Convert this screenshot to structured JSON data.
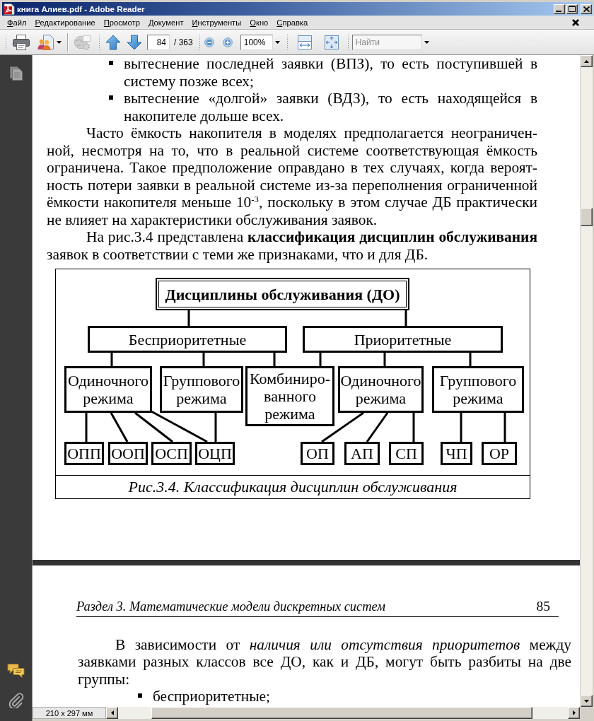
{
  "window": {
    "title": "книга Алиев.pdf - Adobe Reader"
  },
  "menu": [
    "Файл",
    "Редактирование",
    "Просмотр",
    "Документ",
    "Инструменты",
    "Окно",
    "Справка"
  ],
  "toolbar": {
    "items": [
      {
        "kind": "print",
        "disabled": false
      },
      {
        "kind": "share",
        "disabled": false
      },
      {
        "kind": "globe",
        "disabled": true
      },
      {
        "kind": "previous_page",
        "disabled": false
      },
      {
        "kind": "next_page",
        "disabled": false
      },
      {
        "kind": "page_field",
        "value": "84",
        "total": "/ 363"
      },
      {
        "kind": "zoom_out",
        "disabled": false
      },
      {
        "kind": "zoom_in",
        "disabled": false
      },
      {
        "kind": "zoom_field",
        "value": "100%"
      },
      {
        "kind": "fit_width",
        "disabled": false
      },
      {
        "kind": "fit_page",
        "disabled": false
      },
      {
        "kind": "search_field",
        "placeholder": "Найти"
      }
    ]
  },
  "page_1": {
    "blocks": [
      {
        "kind": "bullet",
        "text": "вытеснение последней заявки (ВПЗ), то есть поступившей в систему позже всех;"
      },
      {
        "kind": "bullet",
        "text": "вытеснение «долгой» заявки (ВДЗ), то есть находящейся в накопителе дольше всех."
      },
      {
        "kind": "paragraph",
        "text": "Часто ёмкость накопителя в моделях предполагается неограничен-ной, несмотря на то, что в реальной системе соответствующая ёмкость ограничена. Такое предположение оправдано в тех случаях, когда вероят-ность потери заявки в реальной системе из-за переполнения ограниченной ёмкости накопителя меньше 10$^{-3}$, поскольку в этом случае ДБ практически не влияет на характеристики обслуживания заявок."
      },
      {
        "kind": "paragraph",
        "text": "На рис.3.4 представлена **классификация дисциплин обслуживания** заявок в соответствии с теми же признаками, что и для ДБ."
      }
    ],
    "figure": {
      "root": {
        "label": "Дисциплины обслуживания (ДО)",
        "children": [
          {
            "label": "Бесприоритетные",
            "children": [
              {
                "label": "Одиночного режима",
                "children": [
                  {
                    "label": "ОПП"
                  },
                  {
                    "label": "ООП"
                  },
                  {
                    "label": "ОСП"
                  },
                  {
                    "label": "ОЦП"
                  }
                ]
              },
              {
                "label": "Группового режима"
              },
              {
                "label": "Комбиниро-ванного режима"
              }
            ]
          },
          {
            "label": "Приоритетные",
            "children": [
              {
                "label": "Одиночного режима",
                "children": [
                  {
                    "label": "ОП"
                  },
                  {
                    "label": "АП"
                  },
                  {
                    "label": "СП"
                  }
                ]
              },
              {
                "label": "Группового режима",
                "children": [
                  {
                    "label": "ЧП"
                  },
                  {
                    "label": "ОР"
                  }
                ]
              }
            ]
          }
        ]
      },
      "caption": "Рис.3.4. Классификация дисциплин обслуживания"
    }
  },
  "page_2": {
    "running_header": {
      "title": "Раздел 3. Математические модели дискретных систем",
      "page_number": "85"
    },
    "blocks": [
      {
        "kind": "paragraph",
        "text": "В зависимости от *наличия или отсутствия приоритетов* между заявками разных классов все ДО, как и ДБ, могут быть разбиты на две группы:"
      },
      {
        "kind": "bullet",
        "text": "бесприоритетные;"
      }
    ]
  },
  "status_bar": {
    "page_size": "210 x 297 мм"
  }
}
